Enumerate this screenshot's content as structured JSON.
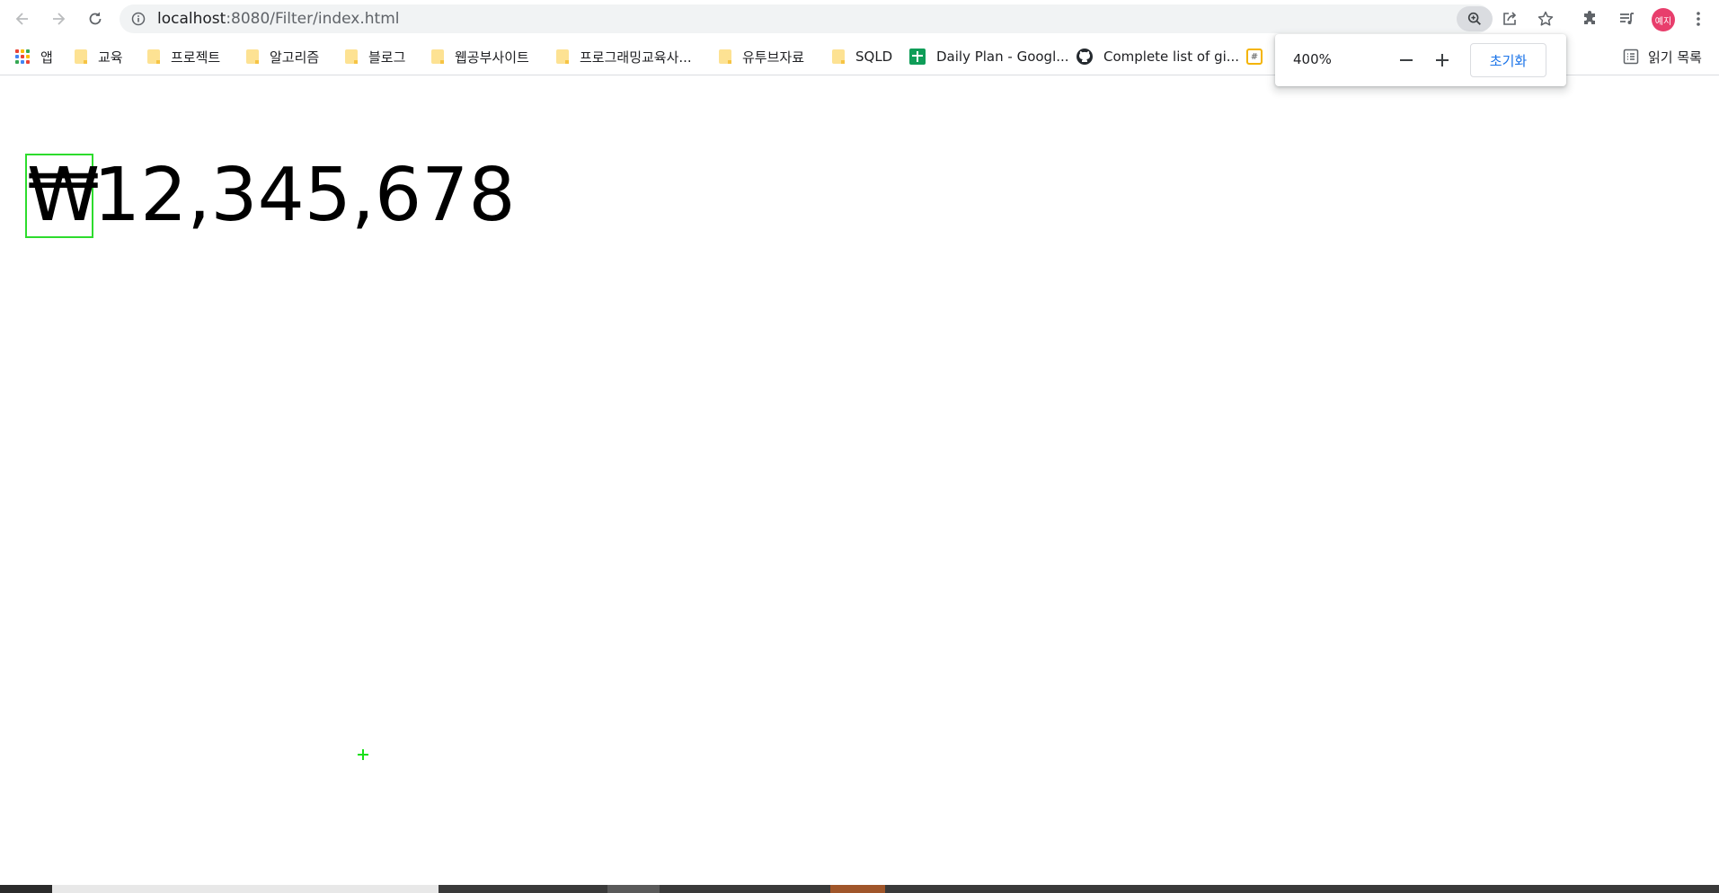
{
  "browser": {
    "url_host": "localhost",
    "url_rest": ":8080/Filter/index.html",
    "profile_initials": "예지"
  },
  "bookmarks": {
    "apps_label": "앱",
    "items": [
      {
        "label": "교육",
        "icon": "folder-icon"
      },
      {
        "label": "프로젝트",
        "icon": "folder-icon"
      },
      {
        "label": "알고리즘",
        "icon": "folder-icon"
      },
      {
        "label": "블로그",
        "icon": "folder-icon"
      },
      {
        "label": "웹공부사이트",
        "icon": "folder-icon"
      },
      {
        "label": "프로그래밍교육사...",
        "icon": "folder-icon"
      },
      {
        "label": "유투브자료",
        "icon": "folder-icon"
      },
      {
        "label": "SQLD",
        "icon": "folder-icon"
      },
      {
        "label": "Daily Plan - Googl...",
        "icon": "sheets-icon"
      },
      {
        "label": "Complete list of gi...",
        "icon": "github-icon"
      }
    ],
    "reading_list_label": "읽기 목록"
  },
  "zoom_popup": {
    "percent": "400%",
    "reset_label": "초기화"
  },
  "page": {
    "currency_symbol": "₩",
    "amount": "12,345,678"
  },
  "colors": {
    "highlight_border": "#2ddc2d",
    "avatar": "#e83e6c",
    "link_blue": "#1a73e8"
  }
}
